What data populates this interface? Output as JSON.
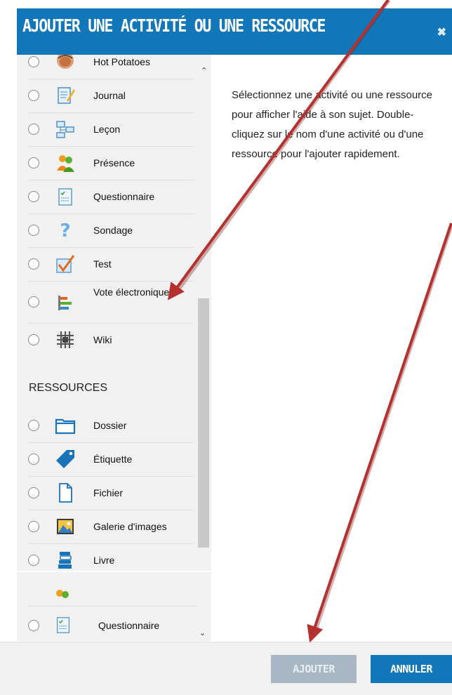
{
  "dialog": {
    "title": "AJOUTER UNE ACTIVITÉ OU UNE RESSOURCE",
    "close_icon": "close-icon"
  },
  "activities": [
    {
      "label": "Hot Potatoes",
      "icon": "hot-potatoes-icon"
    },
    {
      "label": "Journal",
      "icon": "journal-icon"
    },
    {
      "label": "Leçon",
      "icon": "lesson-icon"
    },
    {
      "label": "Présence",
      "icon": "attendance-icon"
    },
    {
      "label": "Questionnaire",
      "icon": "questionnaire-icon"
    },
    {
      "label": "Sondage",
      "icon": "survey-icon"
    },
    {
      "label": "Test",
      "icon": "quiz-icon"
    },
    {
      "label": "Vote électronique",
      "icon": "vote-icon"
    },
    {
      "label": "Wiki",
      "icon": "wiki-icon"
    }
  ],
  "resources_heading": "RESSOURCES",
  "resources": [
    {
      "label": "Dossier",
      "icon": "folder-icon"
    },
    {
      "label": "Étiquette",
      "icon": "label-tag-icon"
    },
    {
      "label": "Fichier",
      "icon": "file-icon"
    },
    {
      "label": "Galerie d'images",
      "icon": "image-gallery-icon"
    },
    {
      "label": "Livre",
      "icon": "book-icon"
    }
  ],
  "lower_list": {
    "label": "Questionnaire",
    "icon": "questionnaire-icon"
  },
  "help": {
    "text": "Sélectionnez une activité ou une ressource pour afficher l'aide à son sujet. Double-cliquez sur le nom d'une activité ou d'une ressource pour l'ajouter rapidement."
  },
  "footer": {
    "add_label": "AJOUTER",
    "cancel_label": "ANNULER"
  },
  "colors": {
    "header": "#1177b9",
    "button_disabled": "#a9b7c4",
    "arrow": "#b5312f"
  }
}
